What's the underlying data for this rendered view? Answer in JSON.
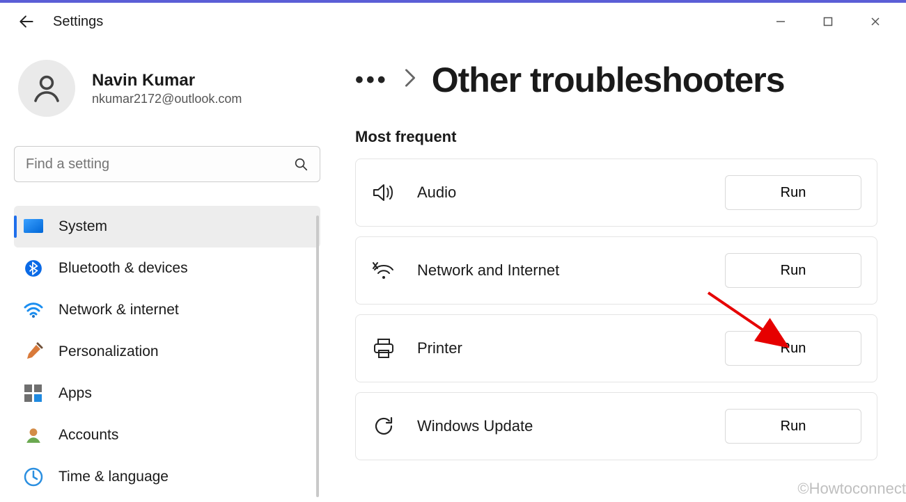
{
  "app": {
    "title": "Settings"
  },
  "profile": {
    "name": "Navin Kumar",
    "email": "nkumar2172@outlook.com"
  },
  "search": {
    "placeholder": "Find a setting"
  },
  "sidebar": {
    "items": [
      {
        "label": "System",
        "active": true
      },
      {
        "label": "Bluetooth & devices"
      },
      {
        "label": "Network & internet"
      },
      {
        "label": "Personalization"
      },
      {
        "label": "Apps"
      },
      {
        "label": "Accounts"
      },
      {
        "label": "Time & language"
      }
    ]
  },
  "breadcrumb": {
    "title": "Other troubleshooters"
  },
  "section": {
    "most_frequent": "Most frequent"
  },
  "troubleshooters": [
    {
      "label": "Audio",
      "button": "Run"
    },
    {
      "label": "Network and Internet",
      "button": "Run"
    },
    {
      "label": "Printer",
      "button": "Run"
    },
    {
      "label": "Windows Update",
      "button": "Run"
    }
  ],
  "watermark": "©Howtoconnect"
}
